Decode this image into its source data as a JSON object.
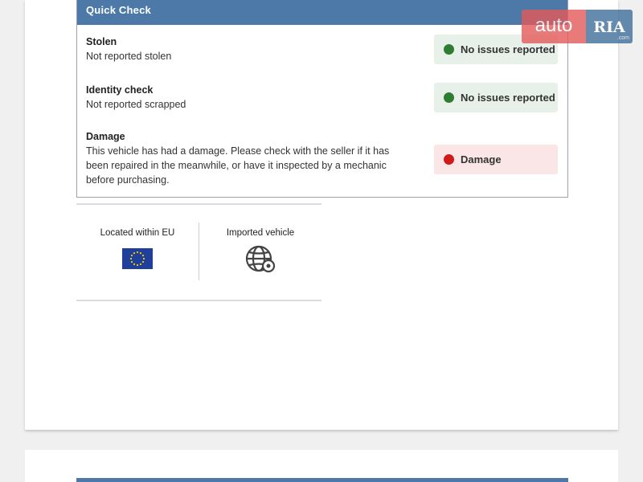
{
  "quick_check": {
    "title": "Quick Check",
    "rows": [
      {
        "title": "Stolen",
        "description": "Not reported stolen",
        "status": "No issues reported",
        "status_type": "ok"
      },
      {
        "title": "Identity check",
        "description": "Not reported scrapped",
        "status": "No issues reported",
        "status_type": "ok"
      },
      {
        "title": "Damage",
        "description": "This vehicle has had a damage. Please check with the seller if it has been repaired in the meanwhile, or have it inspected by a mechanic before purchasing.",
        "status": "Damage",
        "status_type": "bad"
      }
    ]
  },
  "features": [
    {
      "label": "Located within EU",
      "icon": "eu-flag-icon"
    },
    {
      "label": "Imported vehicle",
      "icon": "globe-location-icon"
    }
  ],
  "logo": {
    "left": "auto",
    "right": "RIA",
    "suffix": ".com"
  },
  "colors": {
    "header_blue": "#4d79a8",
    "ok_green": "#2f7d32",
    "ok_bg": "#e8f1e9",
    "bad_red": "#d11a1a",
    "bad_bg": "#fae6e6",
    "logo_red": "#e35a5a",
    "logo_blue": "#3f6f9a"
  }
}
